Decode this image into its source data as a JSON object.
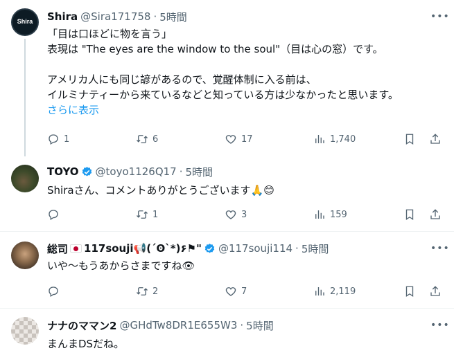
{
  "tweets": [
    {
      "name": "Shira",
      "handle": "@Sira171758",
      "time": "5時間",
      "avatar_text": "Shira",
      "body": "「目は口ほどに物を言う」\n表現は \"The eyes are the window to the soul\"（目は心の窓）です。\n\nアメリカ人にも同じ諺があるので、覚醒体制に入る前は、\nイルミナティーから来ているなどと知っている方は少なかったと思います。",
      "show_more": "さらに表示",
      "replies": "1",
      "retweets": "6",
      "likes": "17",
      "views": "1,740"
    },
    {
      "name": "TOYO",
      "handle": "@toyo1126Q17",
      "time": "5時間",
      "verified": true,
      "body": "Shiraさん、コメントありがとうございます🙏😊",
      "replies": "",
      "retweets": "1",
      "likes": "3",
      "views": "159"
    },
    {
      "name": "総司",
      "name_suffix": "117souji📢(´ʘ`*)۶⚑\"",
      "handle": "@117souji114",
      "time": "5時間",
      "verified": true,
      "body": "いや〜もうあからさまですね👁",
      "replies": "",
      "retweets": "2",
      "likes": "7",
      "views": "2,119"
    },
    {
      "name": "ナナのママン2",
      "handle": "@GHdTw8DR1E655W3",
      "time": "5時間",
      "body": "まんまDSだね。"
    }
  ],
  "colors": {
    "text": "#0f1419",
    "muted": "#536471",
    "link": "#1d9bf0",
    "verified": "#1d9bf0",
    "divider": "#eff3f4"
  },
  "icons": [
    "reply-icon",
    "retweet-icon",
    "like-icon",
    "views-icon",
    "bookmark-icon",
    "share-icon",
    "more-icon",
    "verified-badge-icon"
  ]
}
